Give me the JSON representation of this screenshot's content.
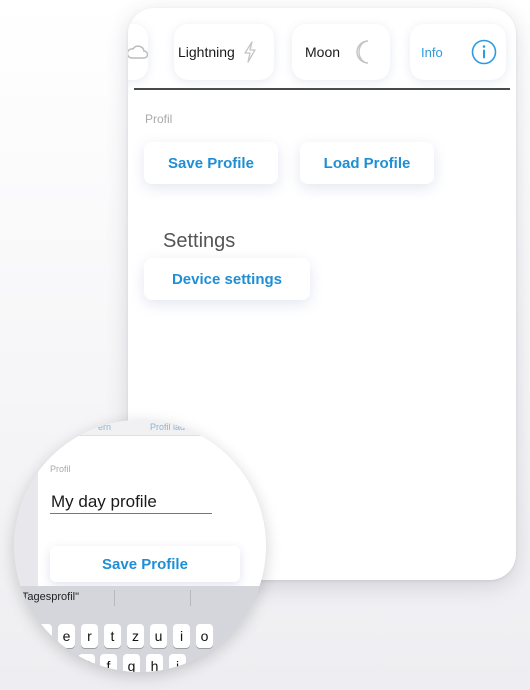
{
  "tabs": {
    "cloud_icon": "cloud-icon",
    "lightning": {
      "label": "Lightning",
      "icon": "lightning-icon"
    },
    "moon": {
      "label": "Moon",
      "icon": "moon-icon"
    },
    "info": {
      "label": "Info",
      "icon": "info-icon"
    }
  },
  "profile": {
    "section_label": "Profil",
    "save_label": "Save Profile",
    "load_label": "Load Profile"
  },
  "settings": {
    "title": "Settings",
    "device_settings_label": "Device settings"
  },
  "zoom": {
    "top_left_fragment": "ern",
    "top_right_fragment": "Profil lad",
    "section_label": "Profil",
    "input_value": "My day profile",
    "save_label": "Save Profile",
    "keyboard_suggestion": "\"Tagesprofil\"",
    "keyboard_row1": [
      "w",
      "e",
      "r",
      "t",
      "z",
      "u",
      "i",
      "o"
    ],
    "keyboard_row2": [
      "d",
      "f",
      "g",
      "h",
      "j"
    ]
  },
  "colors": {
    "accent": "#1f8fd4",
    "info_blue": "#2e9be0",
    "divider": "#4a4a4a",
    "muted": "#aaaaaa"
  }
}
